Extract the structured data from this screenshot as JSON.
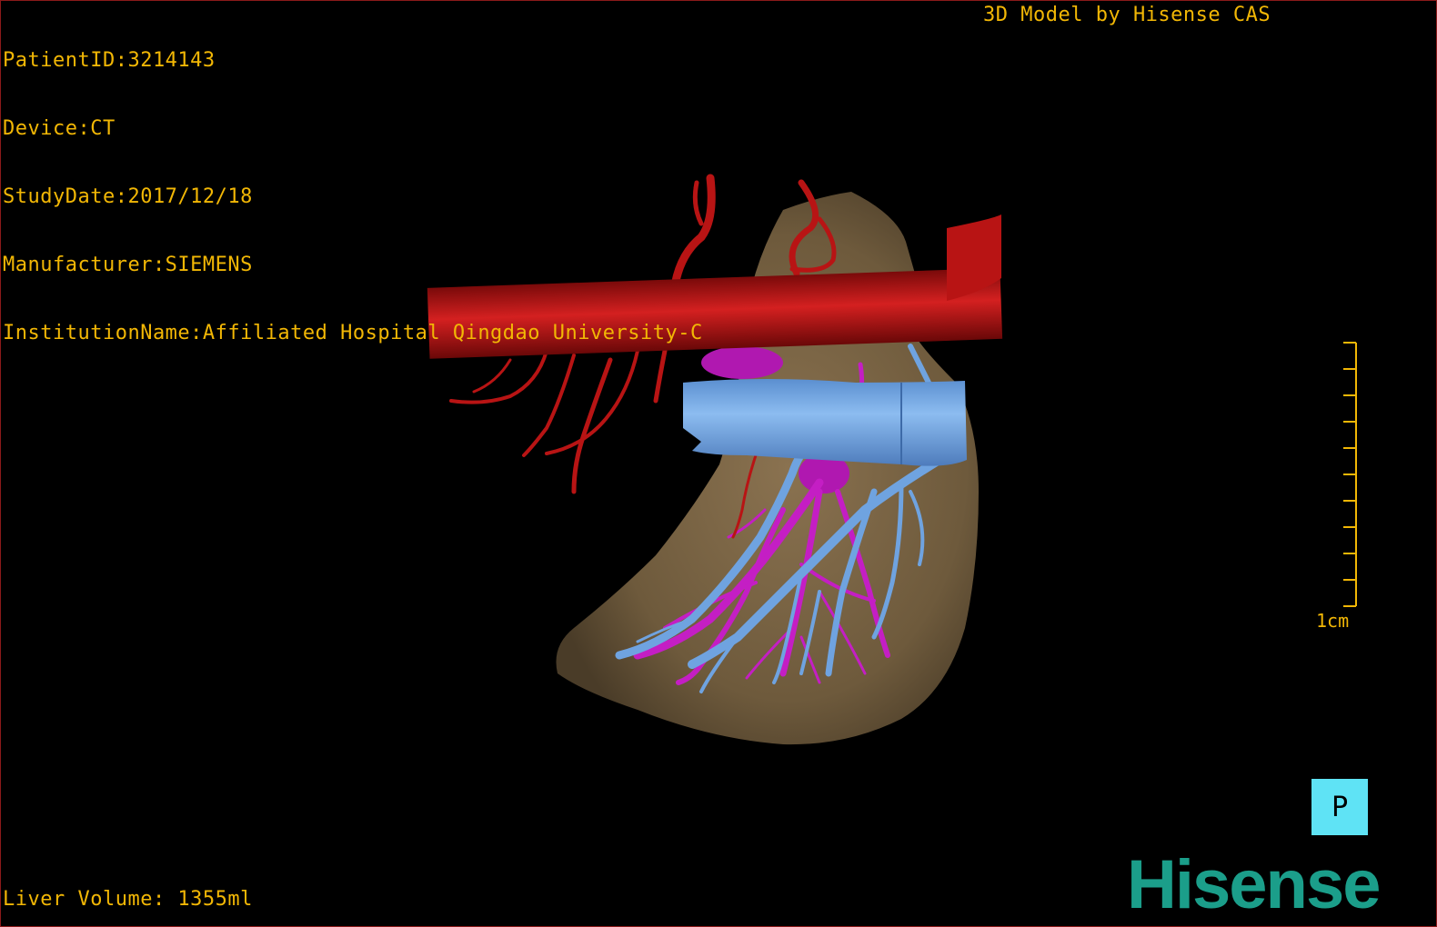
{
  "patient_info": {
    "patient_id": "PatientID:3214143",
    "device": "Device:CT",
    "study_date": "StudyDate:2017/12/18",
    "manufacturer": "Manufacturer:SIEMENS",
    "institution": "InstitutionName:Affiliated Hospital Qingdao University-C"
  },
  "model_credit": "3D Model by Hisense CAS",
  "liver_volume": "Liver Volume: 1355ml",
  "scale_bar": {
    "label": "1cm",
    "ticks": 10
  },
  "orientation_cube": {
    "face_label": "P",
    "color": "#5fe3f5"
  },
  "brand": {
    "name": "Hisense",
    "color": "#1b9e8a"
  },
  "colors": {
    "overlay_text": "#f2b705",
    "liver": "#6e5a3c",
    "artery": "#b81414",
    "vena_cava": "#6fa3e0",
    "portal_vein": "#c41ec4",
    "background": "#000000"
  },
  "structures": [
    "liver",
    "inferior-vena-cava",
    "aorta",
    "hepatic-veins",
    "portal-vein"
  ]
}
